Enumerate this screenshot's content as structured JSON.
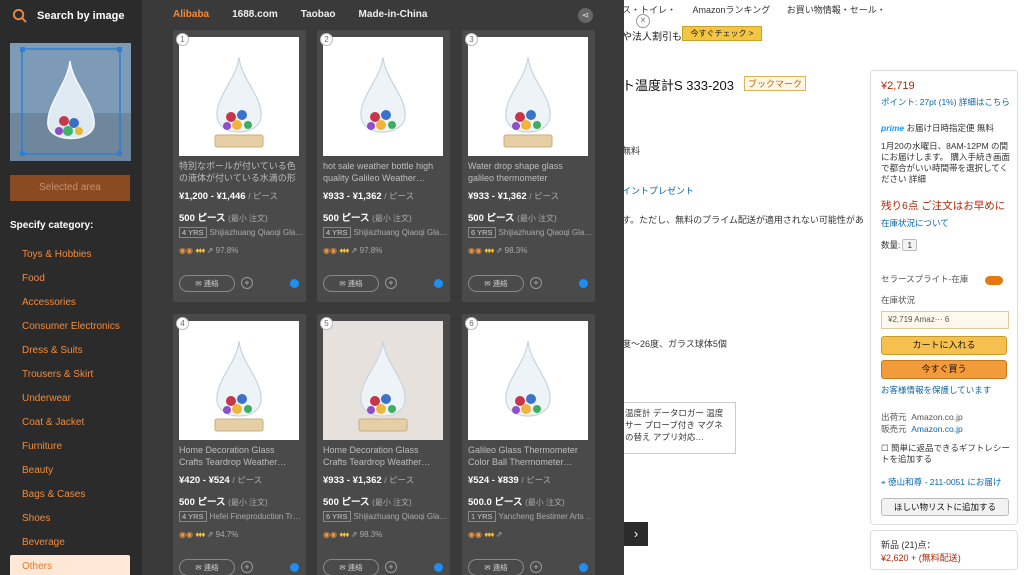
{
  "sidebar": {
    "title": "Search by image",
    "selected_area_label": "Selected area",
    "specify_category_label": "Specify category:",
    "categories": [
      "Toys & Hobbies",
      "Food",
      "Accessories",
      "Consumer Electronics",
      "Dress & Suits",
      "Trousers & Skirt",
      "Underwear",
      "Coat & Jacket",
      "Furniture",
      "Beauty",
      "Bags & Cases",
      "Shoes",
      "Beverage",
      "Others"
    ],
    "active_category": "Others"
  },
  "tabs": [
    "Alibaba",
    "1688.com",
    "Taobao",
    "Made-in-China"
  ],
  "active_tab": "Alibaba",
  "contact_label": "連絡",
  "unit_label": "/ ピース",
  "moq_sub": "(最小 注文)",
  "results": [
    {
      "num": "1",
      "title": "特別なボールが付いている色の液体が付いている水滴の形の…",
      "price": "¥1,200 - ¥1,446",
      "moq": "500 ピース",
      "yrs": "4",
      "supplier": "Shijiazhuang Qiaoqi Gla…",
      "rating": "97.8%"
    },
    {
      "num": "2",
      "title": "hot sale weather bottle high quality Galileo Weather…",
      "price": "¥933 - ¥1,362",
      "moq": "500 ピース",
      "yrs": "4",
      "supplier": "Shijiazhuang Qiaoqi Gla…",
      "rating": "97.8%"
    },
    {
      "num": "3",
      "title": "Water drop shape glass galileo thermometer",
      "price": "¥933 - ¥1,362",
      "moq": "500 ピース",
      "yrs": "6",
      "supplier": "Shijiazhuang Qiaoqi Gla…",
      "rating": "98.3%"
    },
    {
      "num": "4",
      "title": "Home Decoration Glass Crafts Teardrop Weather…",
      "price": "¥420 - ¥524",
      "moq": "500 ピース",
      "yrs": "4",
      "supplier": "Hefei Fineproduction Tr…",
      "rating": "94.7%"
    },
    {
      "num": "5",
      "title": "Home Decoration Glass Crafts Teardrop Weather…",
      "price": "¥933 - ¥1,362",
      "moq": "500 ピース",
      "yrs": "6",
      "supplier": "Shijiazhuang Qiaoqi Gla…",
      "rating": "98.3%"
    },
    {
      "num": "6",
      "title": "Galileo Glass Thermometer Color Ball Thermometer…",
      "price": "¥524 - ¥839",
      "moq": "500.0 ピース",
      "yrs": "1",
      "supplier": "Yancheng Bestimer Arts …",
      "rating": ""
    }
  ],
  "amazon": {
    "nav": [
      "ス・トイレ・",
      "Amazonランキング",
      "お買い物情報・セール・"
    ],
    "banner_text": "や法人割引も",
    "banner_button": "今すぐチェック >",
    "product_title": "ト温度計S 333-203",
    "bookmark": "ブックマーク",
    "free": "無料",
    "point_present": "イントプレゼント",
    "prime_note": "す。ただし、無料のプライム配送が適用されない可能性があ",
    "range_text": "度～26度、ガラス球体5個",
    "spec_text": "温度計 データロガー 温度サー プローブ付き マグネの替え アプリ対応…",
    "price": "¥2,719",
    "points": "ポイント: 27pt (1%) 詳細はこちら",
    "prime": "prime",
    "prime_ship": "お届け日時指定便 無料",
    "delivery": "1月20の水曜日、8AM-12PM の間にお届けします。 購入手続き画面で都合がいい時間帯を選択してください 詳細",
    "stock_warning": "残り6点 ご注文はお早めに",
    "in_stock": "在庫状況について",
    "qty_label": "数量:",
    "qty_value": "1",
    "seller_light": "セラースプライト-在庫",
    "stock_label": "在庫状況",
    "seller_row": "¥2,719   Amaz···   6",
    "add_to_cart": "カートに入れる",
    "buy_now": "今すぐ買う",
    "secure": "お客様情報を保護しています",
    "ships_from_label": "出荷元",
    "ships_from": "Amazon.co.jp",
    "sold_by_label": "販売元",
    "sold_by": "Amazon.co.jp",
    "gift": "簡単に返品できるギフトレシートを追加する",
    "address": "徳山和尊 - 211-0051 にお届け",
    "wishlist": "ほしい物リストに追加する",
    "new_label": "新品 (21)点：",
    "new_price": "¥2,620 + (無料配送)"
  }
}
